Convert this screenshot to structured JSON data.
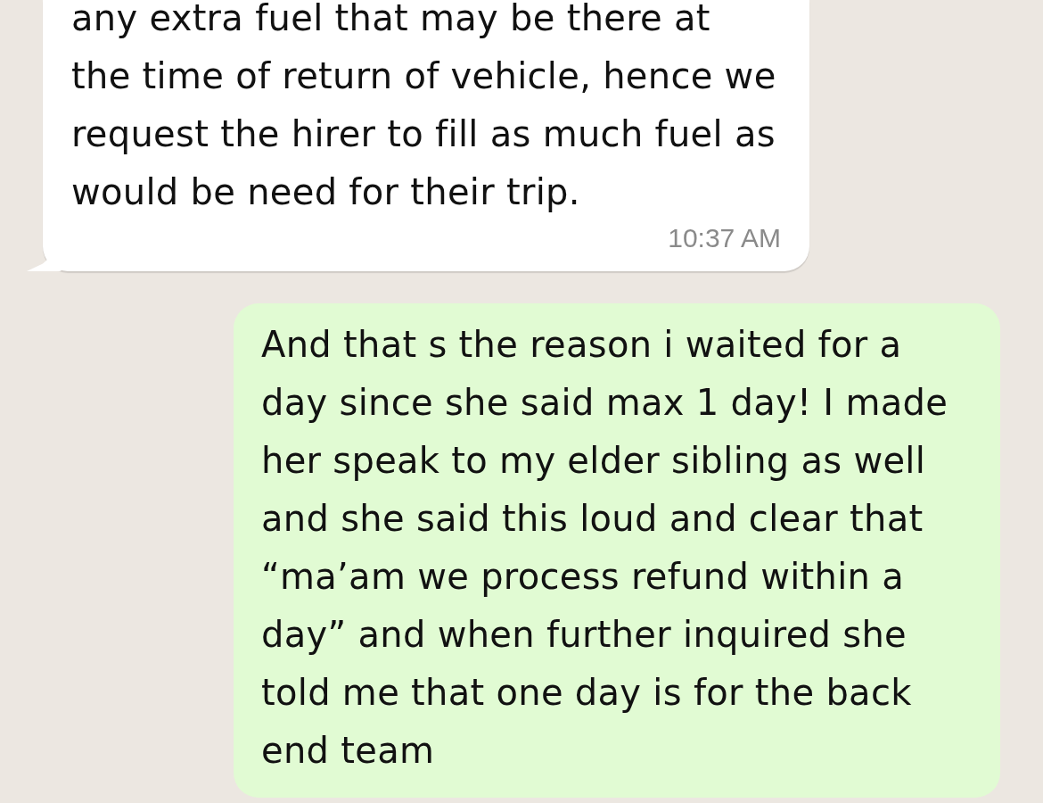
{
  "messages": [
    {
      "kind": "incoming",
      "text": "any extra fuel that may be there at the time of return of vehicle, hence we request the hirer to fill as much fuel as would be need for their trip.",
      "time": "10:37 AM"
    },
    {
      "kind": "outgoing",
      "text": "And that s the reason i waited for a day since she said max 1 day! I made her speak to my elder sibling as well and she said this loud and clear that “ma’am we process refund within a day” and when further inquired she told me that one day is for the back end team"
    }
  ]
}
